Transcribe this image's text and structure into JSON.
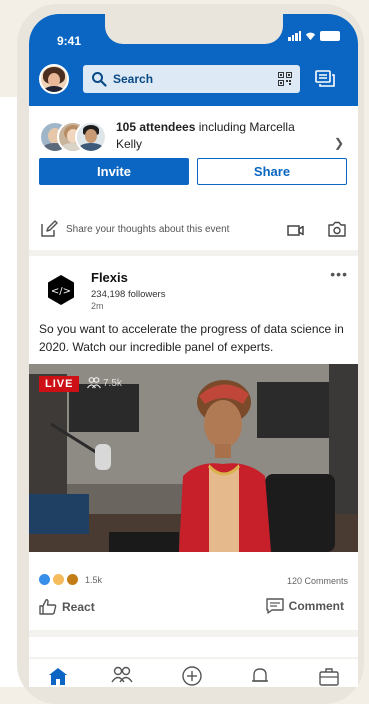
{
  "status": {
    "time": "9:41"
  },
  "search": {
    "placeholder": "Search"
  },
  "event": {
    "attendee_count": "105 attendees",
    "attendee_rest": " including Marcella Kelly",
    "invite_label": "Invite",
    "share_label": "Share"
  },
  "composer": {
    "prompt": "Share your thoughts about this event"
  },
  "post": {
    "company": "Flexis",
    "logo_text": "</>",
    "followers": "234,198 followers",
    "time": "2m",
    "more": "•••",
    "text": "So you want to accelerate the progress of data science in 2020. Watch our incredible panel of experts.",
    "live_label": "LIVE",
    "viewers": "7.5k",
    "reaction_count": "1.5k",
    "comments": "120 Comments",
    "react_label": "React",
    "comment_label": "Comment"
  },
  "colors": {
    "brand": "#0a66c2",
    "live": "#cc1016",
    "background": "#f3f2ef"
  },
  "icons": [
    "search-icon",
    "qr-code-icon",
    "messaging-icon",
    "pencil-icon",
    "video-icon",
    "camera-icon",
    "more-icon",
    "people-icon",
    "like-icon",
    "comment-icon",
    "home-icon",
    "network-icon",
    "post-icon",
    "notifications-icon",
    "jobs-icon"
  ]
}
